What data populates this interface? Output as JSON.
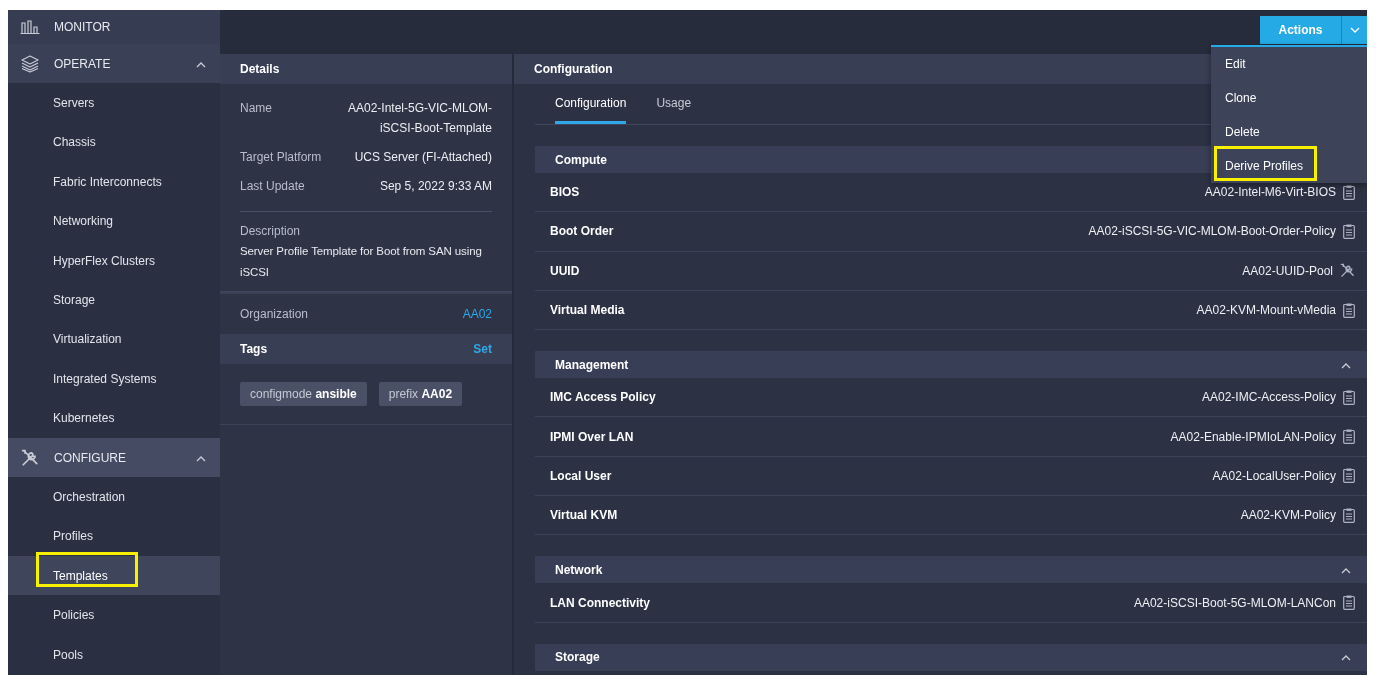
{
  "sidebar": {
    "groups": [
      {
        "label": "MONITOR",
        "expanded": false
      },
      {
        "label": "OPERATE",
        "expanded": true,
        "children": [
          {
            "label": "Servers",
            "selected": false,
            "highlighted": false
          },
          {
            "label": "Chassis",
            "selected": false,
            "highlighted": false
          },
          {
            "label": "Fabric Interconnects",
            "selected": false,
            "highlighted": false
          },
          {
            "label": "Networking",
            "selected": false,
            "highlighted": false
          },
          {
            "label": "HyperFlex Clusters",
            "selected": false,
            "highlighted": false
          },
          {
            "label": "Storage",
            "selected": false,
            "highlighted": false
          },
          {
            "label": "Virtualization",
            "selected": false,
            "highlighted": false
          },
          {
            "label": "Integrated Systems",
            "selected": false,
            "highlighted": false
          },
          {
            "label": "Kubernetes",
            "selected": false,
            "highlighted": false
          }
        ]
      },
      {
        "label": "CONFIGURE",
        "expanded": true,
        "children": [
          {
            "label": "Orchestration",
            "selected": false,
            "highlighted": false
          },
          {
            "label": "Profiles",
            "selected": false,
            "highlighted": false
          },
          {
            "label": "Templates",
            "selected": true,
            "highlighted": true
          },
          {
            "label": "Policies",
            "selected": false,
            "highlighted": false
          },
          {
            "label": "Pools",
            "selected": false,
            "highlighted": false
          }
        ]
      }
    ]
  },
  "actions": {
    "label": "Actions",
    "menu": [
      {
        "label": "Edit",
        "highlighted": false
      },
      {
        "label": "Clone",
        "highlighted": false
      },
      {
        "label": "Delete",
        "highlighted": false
      },
      {
        "label": "Derive Profiles",
        "highlighted": true
      }
    ]
  },
  "details": {
    "title": "Details",
    "fields": [
      {
        "label": "Name",
        "value": "AA02-Intel-5G-VIC-MLOM-iSCSI-Boot-Template"
      },
      {
        "label": "Target Platform",
        "value": "UCS Server (FI-Attached)"
      },
      {
        "label": "Last Update",
        "value": "Sep 5, 2022 9:33 AM"
      }
    ],
    "description_label": "Description",
    "description": "Server Profile Template for Boot from SAN using iSCSI",
    "organization_label": "Organization",
    "organization": "AA02",
    "tags_title": "Tags",
    "tags_action": "Set",
    "tags": [
      {
        "key": "configmode",
        "value": "ansible"
      },
      {
        "key": "prefix",
        "value": "AA02"
      }
    ]
  },
  "configuration": {
    "title": "Configuration",
    "tabs": [
      {
        "label": "Configuration",
        "selected": true
      },
      {
        "label": "Usage",
        "selected": false
      }
    ],
    "sections": [
      {
        "title": "Compute",
        "rows": [
          {
            "label": "BIOS",
            "value": "AA02-Intel-M6-Virt-BIOS",
            "kind": "policy"
          },
          {
            "label": "Boot Order",
            "value": "AA02-iSCSI-5G-VIC-MLOM-Boot-Order-Policy",
            "kind": "policy"
          },
          {
            "label": "UUID",
            "value": "AA02-UUID-Pool",
            "kind": "pool"
          },
          {
            "label": "Virtual Media",
            "value": "AA02-KVM-Mount-vMedia",
            "kind": "policy"
          }
        ]
      },
      {
        "title": "Management",
        "expanded": true,
        "rows": [
          {
            "label": "IMC Access Policy",
            "value": "AA02-IMC-Access-Policy",
            "kind": "policy"
          },
          {
            "label": "IPMI Over LAN",
            "value": "AA02-Enable-IPMIoLAN-Policy",
            "kind": "policy"
          },
          {
            "label": "Local User",
            "value": "AA02-LocalUser-Policy",
            "kind": "policy"
          },
          {
            "label": "Virtual KVM",
            "value": "AA02-KVM-Policy",
            "kind": "policy"
          }
        ]
      },
      {
        "title": "Network",
        "expanded": true,
        "rows": [
          {
            "label": "LAN Connectivity",
            "value": "AA02-iSCSI-Boot-5G-MLOM-LANCon",
            "kind": "policy"
          }
        ]
      },
      {
        "title": "Storage",
        "expanded": true
      }
    ]
  }
}
